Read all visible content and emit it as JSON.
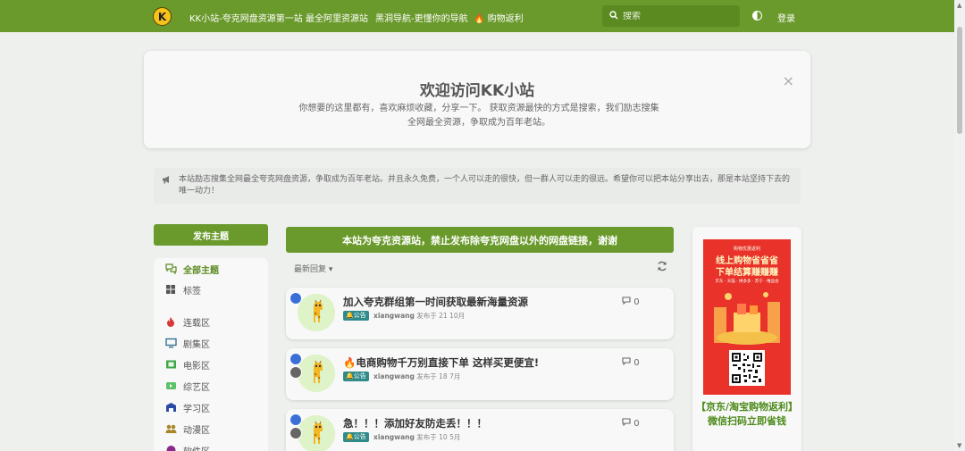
{
  "header": {
    "logo_text": "K",
    "nav": [
      {
        "label": "KK小站-夸克网盘资源第一站"
      },
      {
        "label": "最全阿里资源站"
      },
      {
        "label": "黑洞导航-更懂你的导航"
      },
      {
        "label": "购物返利"
      }
    ],
    "search_placeholder": "搜索",
    "login_label": "登录"
  },
  "welcome": {
    "title": "欢迎访问KK小站",
    "text": "你想要的这里都有，喜欢麻烦收藏，分享一下。 获取资源最快的方式是搜索，我们励志搜集全网最全资源，争取成为百年老站。",
    "close_label": "×"
  },
  "notice": {
    "text": "本站励志搜集全网最全夸克网盘资源，争取成为百年老站。并且永久免费，一个人可以走的很快，但一群人可以走的很远。希望你可以把本站分享出去，那是本站坚持下去的唯一动力！"
  },
  "sidebar": {
    "post_button": "发布主题",
    "items": [
      {
        "label": "全部主题",
        "icon": "comments-icon",
        "color": "#5a8a20"
      },
      {
        "label": "标签",
        "icon": "grid-icon",
        "color": "#555555"
      },
      {
        "label": "连载区",
        "icon": "fire-icon",
        "color": "#d93838"
      },
      {
        "label": "剧集区",
        "icon": "tv-icon",
        "color": "#2b6a8a"
      },
      {
        "label": "电影区",
        "icon": "film-icon",
        "color": "#3fa84a"
      },
      {
        "label": "综艺区",
        "icon": "video-icon",
        "color": "#5bc26b"
      },
      {
        "label": "学习区",
        "icon": "school-icon",
        "color": "#2a4aa8"
      },
      {
        "label": "动漫区",
        "icon": "users-icon",
        "color": "#a8862a"
      },
      {
        "label": "软件区",
        "icon": "app-icon",
        "color": "#8a2a8a"
      }
    ]
  },
  "main": {
    "banner": "本站为夸克资源站，禁止发布除夸克网盘以外的网盘链接，谢谢",
    "sort_label": "最新回复",
    "topics": [
      {
        "title": "加入夸克群组第一时间获取最新海量资源",
        "tag": "公告",
        "author": "xiangwang",
        "date": "发布于 21 10月",
        "replies": "0",
        "locked": false
      },
      {
        "title": "电商购物千万别直接下单 这样买更便宜!",
        "tag": "公告",
        "author": "xiangwang",
        "date": "发布于 18 7月",
        "replies": "0",
        "locked": true
      },
      {
        "title": "急！！！添加好友防走丢！！！",
        "tag": "公告",
        "author": "xiangwang",
        "date": "发布于 10 5月",
        "replies": "0",
        "locked": true
      }
    ]
  },
  "ad": {
    "poster_small": "购物优惠返利",
    "poster_line1": "线上购物省省省",
    "poster_line2": "下单结算赚赚赚",
    "poster_sub": "京东 · 天猫 · 拼多多 · 苏宁 · 唯品会",
    "caption_line1": "【京东/淘宝购物返利】",
    "caption_line2": "微信扫码立即省钱"
  },
  "colors": {
    "brand": "#6a9a2c",
    "tag": "#2f8a8a",
    "ad_red": "#e8322a"
  }
}
